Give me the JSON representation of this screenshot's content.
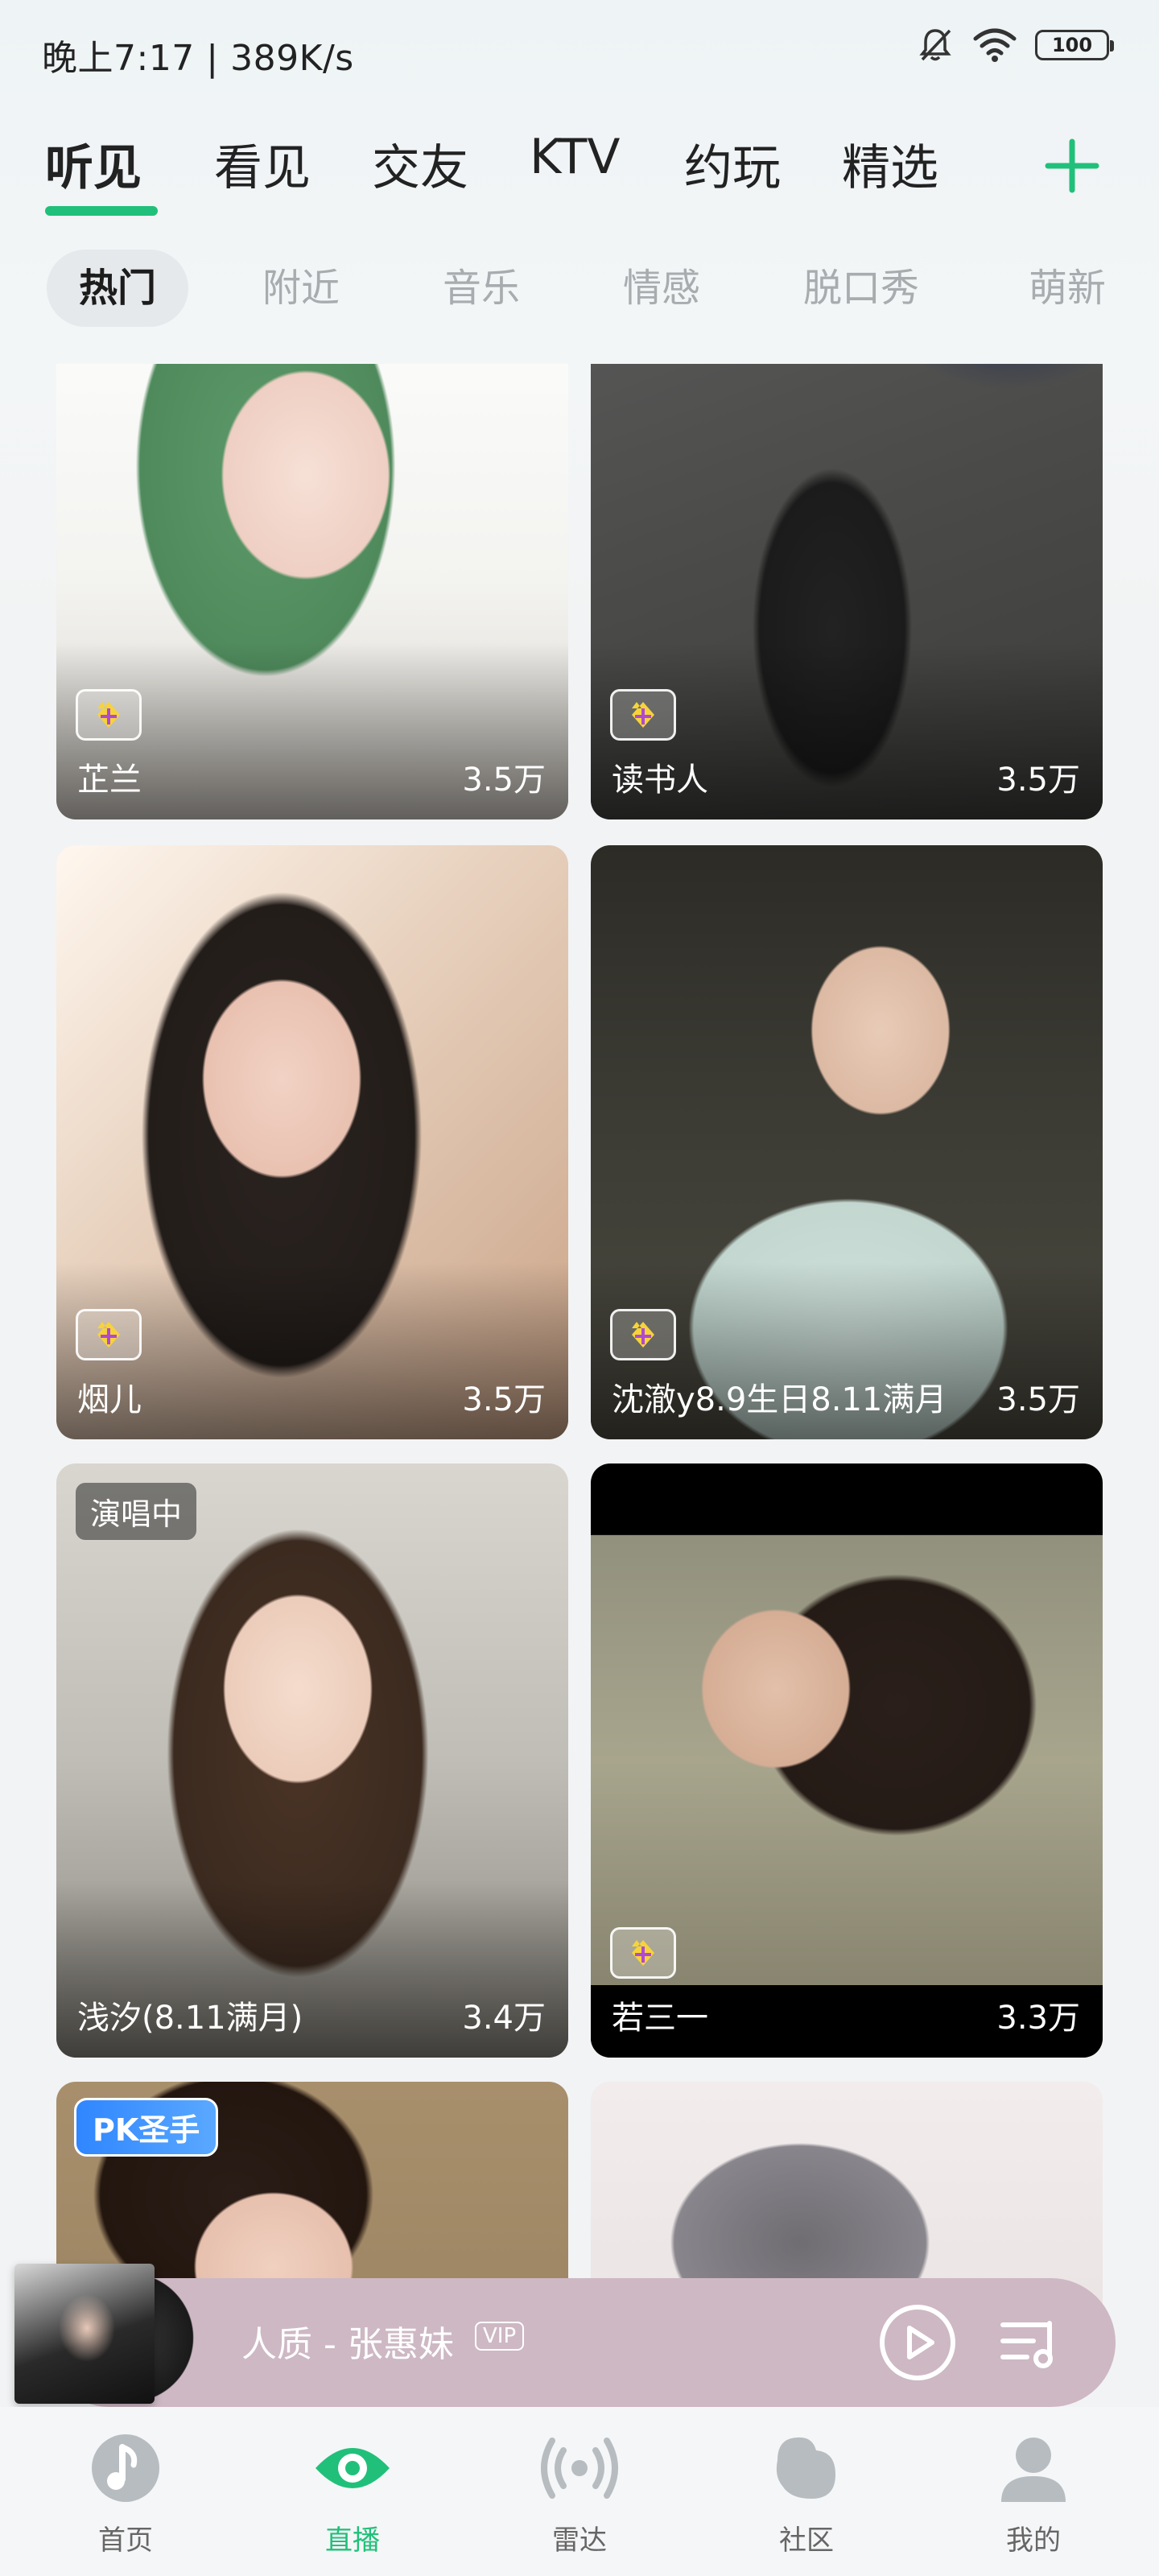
{
  "status_bar": {
    "time": "晚上7:17 | 389K/s",
    "battery": "100"
  },
  "main_tabs": [
    {
      "label": "听见",
      "active": true
    },
    {
      "label": "看见",
      "active": false
    },
    {
      "label": "交友",
      "active": false
    },
    {
      "label": "KTV",
      "active": false
    },
    {
      "label": "约玩",
      "active": false
    },
    {
      "label": "精选",
      "active": false
    }
  ],
  "sub_tabs": [
    {
      "label": "热门",
      "active": true
    },
    {
      "label": "附近",
      "active": false
    },
    {
      "label": "音乐",
      "active": false
    },
    {
      "label": "情感",
      "active": false
    },
    {
      "label": "脱口秀",
      "active": false
    },
    {
      "label": "萌新",
      "active": false
    }
  ],
  "rooms": [
    {
      "name": "芷兰",
      "viewers": "3.5万",
      "award_badge": true
    },
    {
      "name": "读书人",
      "viewers": "3.5万",
      "award_badge": true
    },
    {
      "name": "烟儿",
      "viewers": "3.5万",
      "award_badge": true
    },
    {
      "name": "沈澈y8.9生日8.11满月",
      "viewers": "3.5万",
      "award_badge": true
    },
    {
      "name": "浅汐(8.11满月)",
      "viewers": "3.4万",
      "award_badge": false,
      "tag": "演唱中"
    },
    {
      "name": "若三一",
      "viewers": "3.3万",
      "award_badge": true
    },
    {
      "name": "",
      "viewers": "",
      "tag": "PK圣手"
    },
    {
      "name": "",
      "viewers": ""
    }
  ],
  "player": {
    "title": "人质 - 张惠妹",
    "vip": "VIP"
  },
  "bottom_nav": [
    {
      "label": "首页",
      "icon": "music-note-icon",
      "active": false
    },
    {
      "label": "直播",
      "icon": "eye-icon",
      "active": true
    },
    {
      "label": "雷达",
      "icon": "radar-icon",
      "active": false
    },
    {
      "label": "社区",
      "icon": "community-icon",
      "active": false
    },
    {
      "label": "我的",
      "icon": "profile-icon",
      "active": false
    }
  ],
  "colors": {
    "accent": "#21c07a",
    "player_bg": "#cdb8c4"
  }
}
